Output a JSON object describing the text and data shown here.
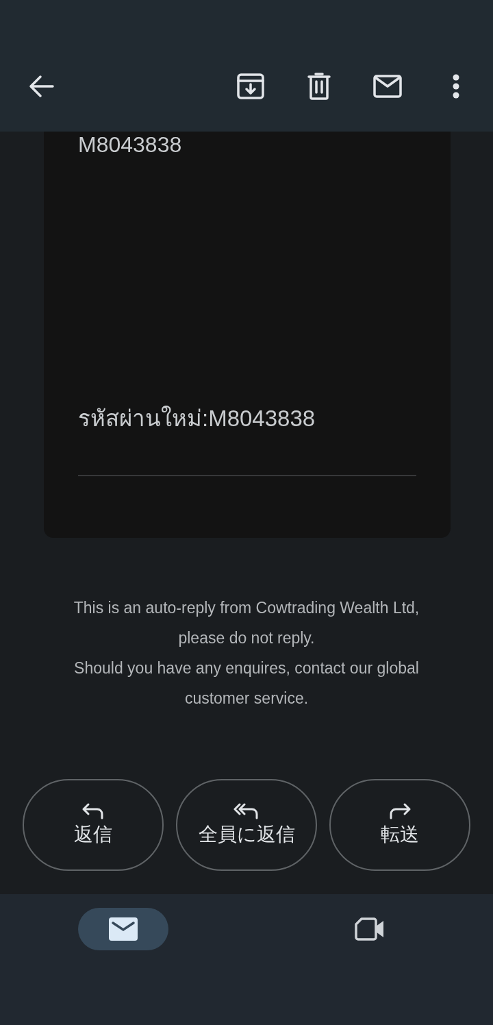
{
  "email_body": {
    "lines": [
      {
        "kind": "code",
        "text": "M8043838"
      },
      {
        "kind": "password",
        "text": "รหัสผ่านใหม่:M8043838"
      }
    ]
  },
  "footer": [
    "This is an auto-reply from Cowtrading Wealth Ltd, please do not reply.",
    "Should you have any enquires, contact our global customer service."
  ],
  "actions": [
    {
      "kind": "reply",
      "label": "返信"
    },
    {
      "kind": "reply_all",
      "label": "全員に返信"
    },
    {
      "kind": "forward",
      "label": "転送"
    }
  ],
  "bottom_nav": [
    {
      "kind": "mail",
      "selected": true
    },
    {
      "kind": "video",
      "selected": false
    }
  ]
}
